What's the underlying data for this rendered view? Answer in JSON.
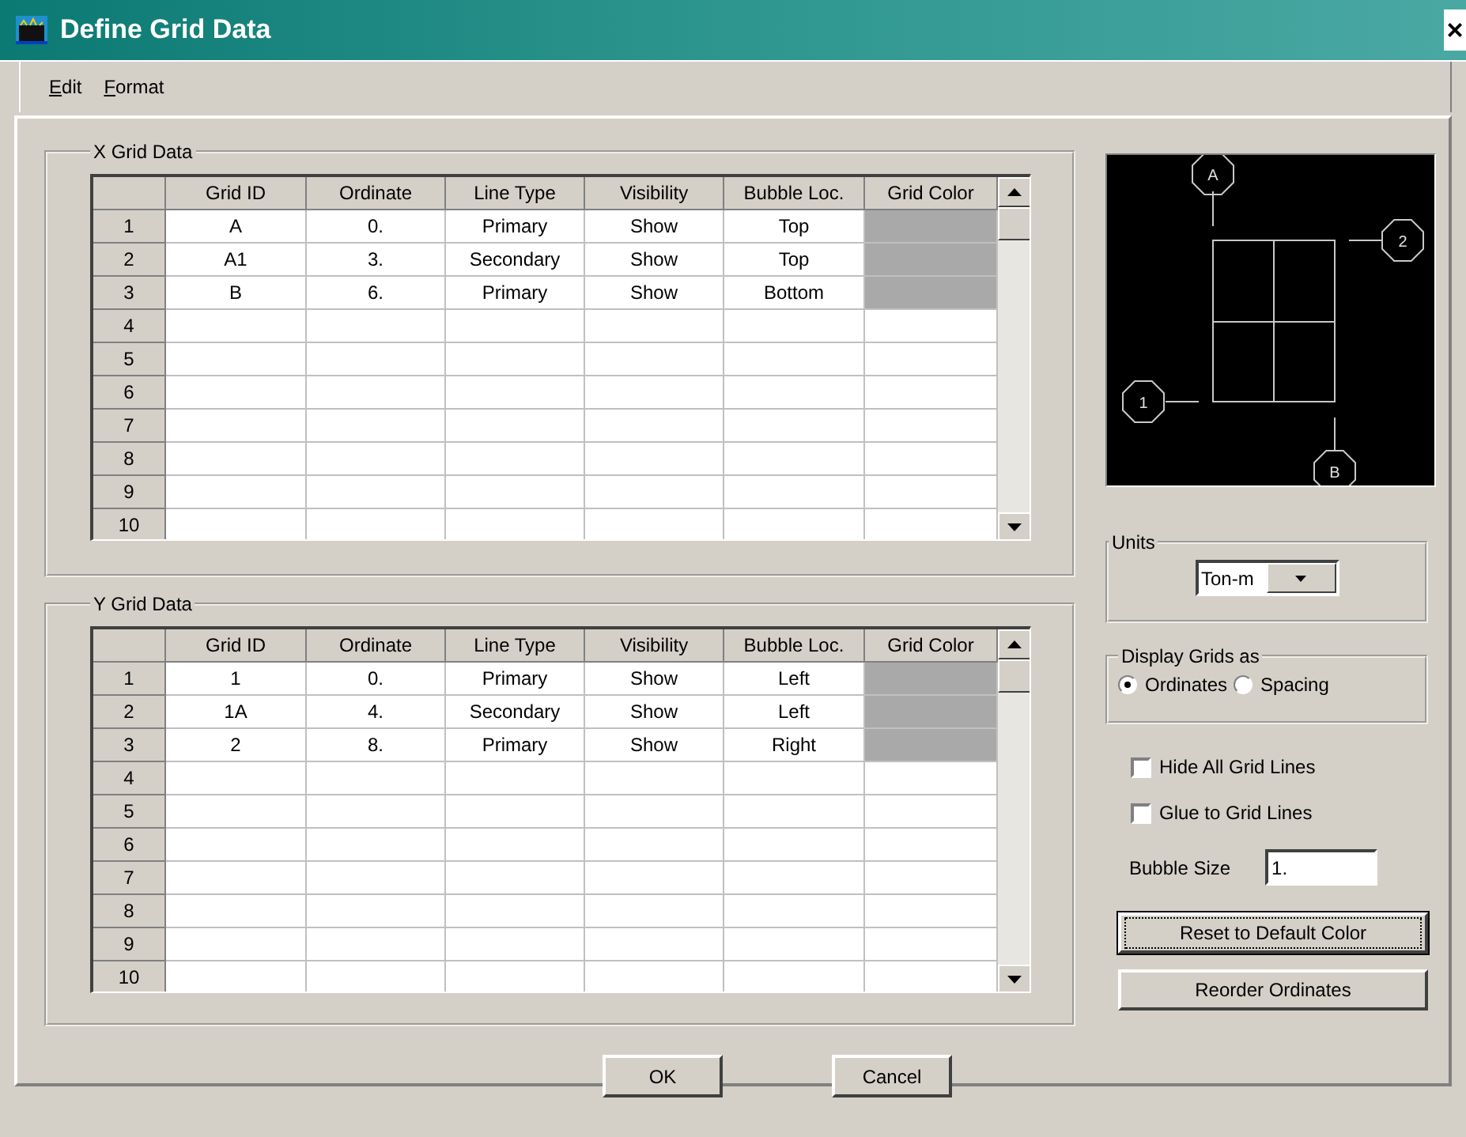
{
  "window": {
    "title": "Define Grid Data",
    "close": "×"
  },
  "menu": [
    {
      "label": "Edit"
    },
    {
      "label": "Format"
    }
  ],
  "x_grid": {
    "title": "X Grid Data",
    "columns": [
      "Grid ID",
      "Ordinate",
      "Line Type",
      "Visibility",
      "Bubble Loc.",
      "Grid Color"
    ],
    "rows": [
      {
        "number": "1",
        "cells": [
          "A",
          "0.",
          "Primary",
          "Show",
          "Top"
        ],
        "color": "#a9a9a9"
      },
      {
        "number": "2",
        "cells": [
          "A1",
          "3.",
          "Secondary",
          "Show",
          "Top"
        ],
        "color": "#a9a9a9"
      },
      {
        "number": "3",
        "cells": [
          "B",
          "6.",
          "Primary",
          "Show",
          "Bottom"
        ],
        "color": "#a9a9a9"
      },
      {
        "number": "4"
      },
      {
        "number": "5"
      },
      {
        "number": "6"
      },
      {
        "number": "7"
      },
      {
        "number": "8"
      },
      {
        "number": "9"
      },
      {
        "number": "10"
      }
    ]
  },
  "y_grid": {
    "title": "Y Grid Data",
    "columns": [
      "Grid ID",
      "Ordinate",
      "Line Type",
      "Visibility",
      "Bubble Loc.",
      "Grid Color"
    ],
    "rows": [
      {
        "number": "1",
        "cells": [
          "1",
          "0.",
          "Primary",
          "Show",
          "Left"
        ],
        "color": "#a9a9a9"
      },
      {
        "number": "2",
        "cells": [
          "1A",
          "4.",
          "Secondary",
          "Show",
          "Left"
        ],
        "color": "#a9a9a9"
      },
      {
        "number": "3",
        "cells": [
          "2",
          "8.",
          "Primary",
          "Show",
          "Right"
        ],
        "color": "#a9a9a9"
      },
      {
        "number": "4"
      },
      {
        "number": "5"
      },
      {
        "number": "6"
      },
      {
        "number": "7"
      },
      {
        "number": "8"
      },
      {
        "number": "9"
      },
      {
        "number": "10"
      }
    ]
  },
  "preview": {
    "bubbles": [
      "A",
      "2",
      "1",
      "B"
    ]
  },
  "units": {
    "title": "Units",
    "value": "Ton-m"
  },
  "display_grids": {
    "title": "Display Grids as",
    "options": [
      {
        "label": "Ordinates",
        "selected": true
      },
      {
        "label": "Spacing",
        "selected": false
      }
    ]
  },
  "checkboxes": [
    {
      "label": "Hide All Grid Lines",
      "checked": false
    },
    {
      "label": "Glue to Grid Lines",
      "checked": false
    }
  ],
  "bubble_size": {
    "label": "Bubble Size",
    "value": "1."
  },
  "side_buttons": [
    {
      "label": "Reset to Default Color",
      "focused": true
    },
    {
      "label": "Reorder Ordinates",
      "focused": false
    }
  ],
  "buttons": [
    {
      "label": "OK"
    },
    {
      "label": "Cancel"
    }
  ]
}
